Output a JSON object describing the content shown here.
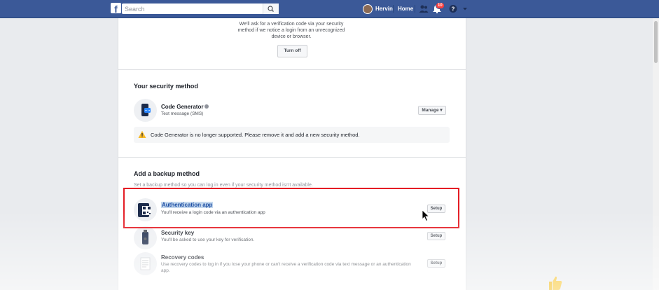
{
  "topbar": {
    "logo": "f",
    "search_placeholder": "Search",
    "user_name": "Hervin",
    "home_label": "Home",
    "notification_count": "10"
  },
  "two_factor": {
    "intro_text": "We'll ask for a verification code via your security method if we notice a login from an unrecognized device or browser.",
    "turn_off_label": "Turn off"
  },
  "security_method": {
    "heading": "Your security method",
    "item_title": "Code Generator",
    "item_desc": "Text message (SMS)",
    "manage_label": "Manage",
    "warning_text": "Code Generator is no longer supported. Please remove it and add a new security method."
  },
  "backup": {
    "heading": "Add a backup method",
    "subtext": "Set a backup method so you can log in even if your security method isn't available.",
    "items": [
      {
        "title": "Authentication app",
        "desc": "You'll receive a login code via an authentication app",
        "button": "Setup"
      },
      {
        "title": "Security key",
        "desc": "You'll be asked to use your key for verification.",
        "button": "Setup"
      },
      {
        "title": "Recovery codes",
        "desc": "Use recovery codes to log in if you lose your phone or can't receive a verification code via text message or an authentication app.",
        "button": "Setup"
      }
    ]
  },
  "colors": {
    "brand": "#3b5998",
    "highlight_border": "#e41c24",
    "warning": "#f7b928"
  }
}
